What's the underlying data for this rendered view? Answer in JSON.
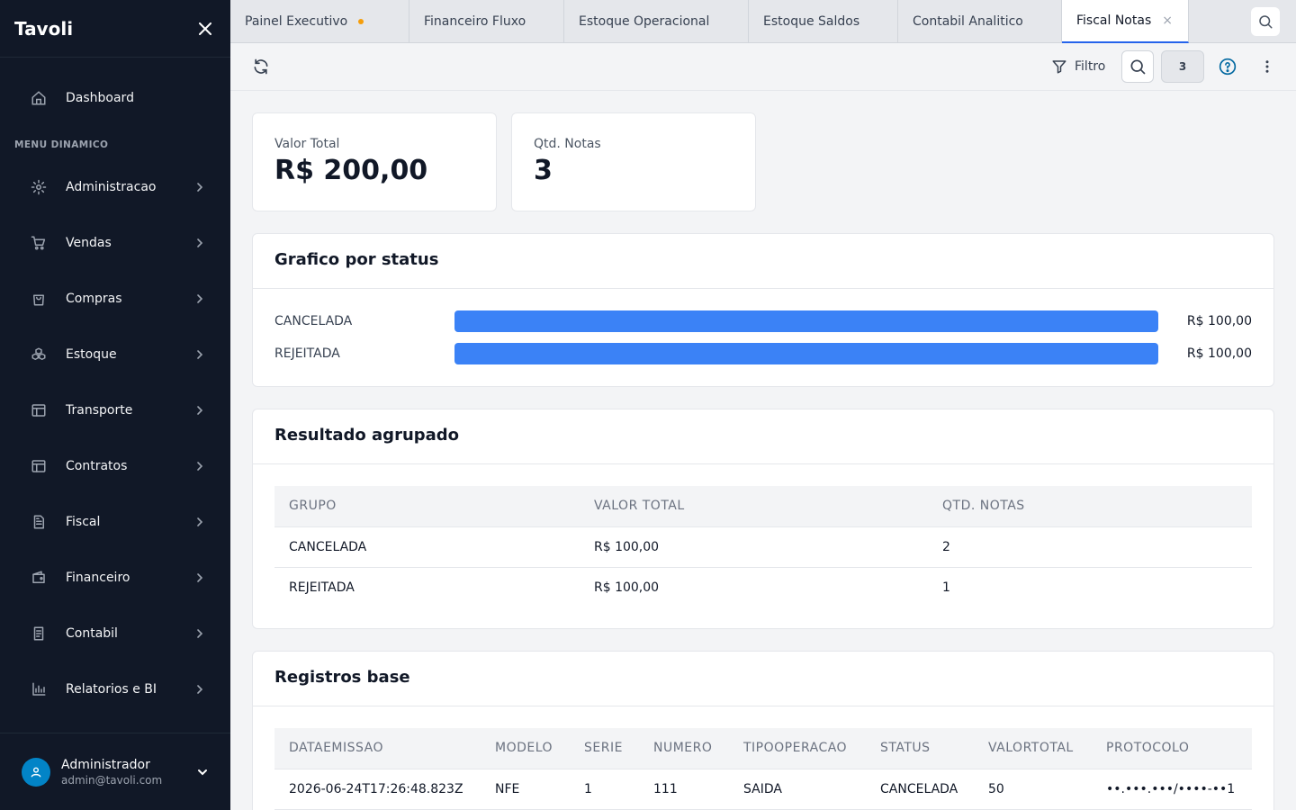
{
  "sidebar": {
    "brand": "Tavoli",
    "dashboard_label": "Dashboard",
    "section_label": "MENU DINAMICO",
    "items": [
      {
        "label": "Administracao",
        "icon": "gear-icon"
      },
      {
        "label": "Vendas",
        "icon": "cart-icon"
      },
      {
        "label": "Compras",
        "icon": "shopping-bag-icon"
      },
      {
        "label": "Estoque",
        "icon": "boxes-icon"
      },
      {
        "label": "Transporte",
        "icon": "layout-icon"
      },
      {
        "label": "Contratos",
        "icon": "layout-icon"
      },
      {
        "label": "Fiscal",
        "icon": "document-icon"
      },
      {
        "label": "Financeiro",
        "icon": "wallet-icon"
      },
      {
        "label": "Contabil",
        "icon": "book-icon"
      },
      {
        "label": "Relatorios e BI",
        "icon": "bar-chart-icon"
      }
    ],
    "user": {
      "name": "Administrador",
      "email": "admin@tavoli.com"
    }
  },
  "tabs": [
    {
      "label": "Painel Executivo",
      "has_dot": true
    },
    {
      "label": "Financeiro Fluxo"
    },
    {
      "label": "Estoque Operacional"
    },
    {
      "label": "Estoque Saldos"
    },
    {
      "label": "Contabil Analitico"
    },
    {
      "label": "Fiscal Notas",
      "active": true,
      "close": "×"
    }
  ],
  "toolbar": {
    "filter_label": "Filtro",
    "count": "3"
  },
  "kpis": [
    {
      "label": "Valor Total",
      "value": "R$ 200,00"
    },
    {
      "label": "Qtd. Notas",
      "value": "3"
    }
  ],
  "chart_panel": {
    "title": "Grafico por status"
  },
  "chart_data": {
    "type": "bar",
    "orientation": "horizontal",
    "categories": [
      "CANCELADA",
      "REJEITADA"
    ],
    "values": [
      100,
      100
    ],
    "value_labels": [
      "R$ 100,00",
      "R$ 100,00"
    ],
    "colors": [
      "#3b82f6"
    ]
  },
  "grouped": {
    "title": "Resultado agrupado",
    "columns": [
      "GRUPO",
      "VALOR TOTAL",
      "QTD. NOTAS"
    ],
    "rows": [
      [
        "CANCELADA",
        "R$ 100,00",
        "2"
      ],
      [
        "REJEITADA",
        "R$ 100,00",
        "1"
      ]
    ]
  },
  "records": {
    "title": "Registros base",
    "columns": [
      "DATAEMISSAO",
      "MODELO",
      "SERIE",
      "NUMERO",
      "TIPOOPERACAO",
      "STATUS",
      "VALORTOTAL",
      "PROTOCOLO"
    ],
    "rows": [
      [
        "2026-06-24T17:26:48.823Z",
        "NFE",
        "1",
        "111",
        "SAIDA",
        "CANCELADA",
        "50",
        "••.•••.•••/••••-••1"
      ]
    ]
  },
  "colors": {
    "sidebar_bg": "#111827",
    "accent": "#2563eb",
    "bar": "#3b82f6",
    "tab_dot": "#f59e0b",
    "help": "#0369a1"
  }
}
